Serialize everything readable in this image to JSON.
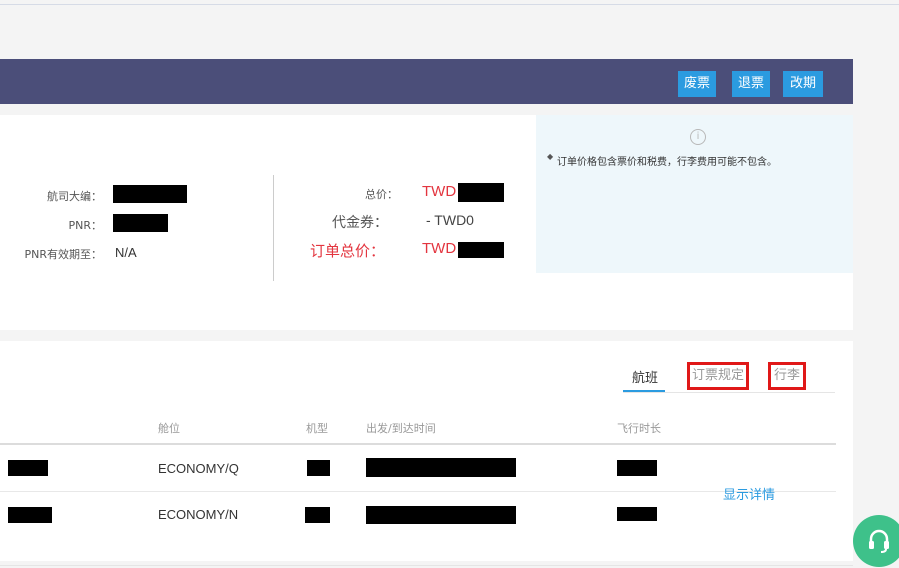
{
  "header": {
    "buttons": {
      "void": "废票",
      "refund": "退票",
      "change": "改期"
    }
  },
  "order_info": {
    "airline_pnr_label": "航司大编：",
    "pnr_label": "PNR：",
    "pnr_expiry_label": "PNR有效期至：",
    "pnr_expiry_value": "N/A"
  },
  "price": {
    "total_label": "总价：",
    "total_currency": "TWD",
    "coupon_label": "代金券：",
    "coupon_value": "- TWD0",
    "order_total_label": "订单总价：",
    "order_total_currency": "TWD"
  },
  "notice": {
    "icon": "info-icon",
    "glyph": "i",
    "text": "订单价格包含票价和税费，行李费用可能不包含。"
  },
  "tabs": {
    "flight": "航班",
    "booking_rules": "订票规定",
    "baggage": "行李"
  },
  "table": {
    "headers": {
      "cabin": "舱位",
      "aircraft": "机型",
      "depart_arrive": "出发/到达时间",
      "duration": "飞行时长"
    },
    "rows": [
      {
        "cabin": "ECONOMY/Q"
      },
      {
        "cabin": "ECONOMY/N"
      }
    ],
    "details_link": "显示详情"
  },
  "colors": {
    "header_bg": "#4b4e79",
    "button_bg": "#2b9be0",
    "price_red": "#e3353f",
    "highlight_border": "#e01818",
    "notice_bg": "#eef7fb",
    "support_green": "#3ec18a"
  },
  "support": {
    "icon": "headset-icon"
  }
}
